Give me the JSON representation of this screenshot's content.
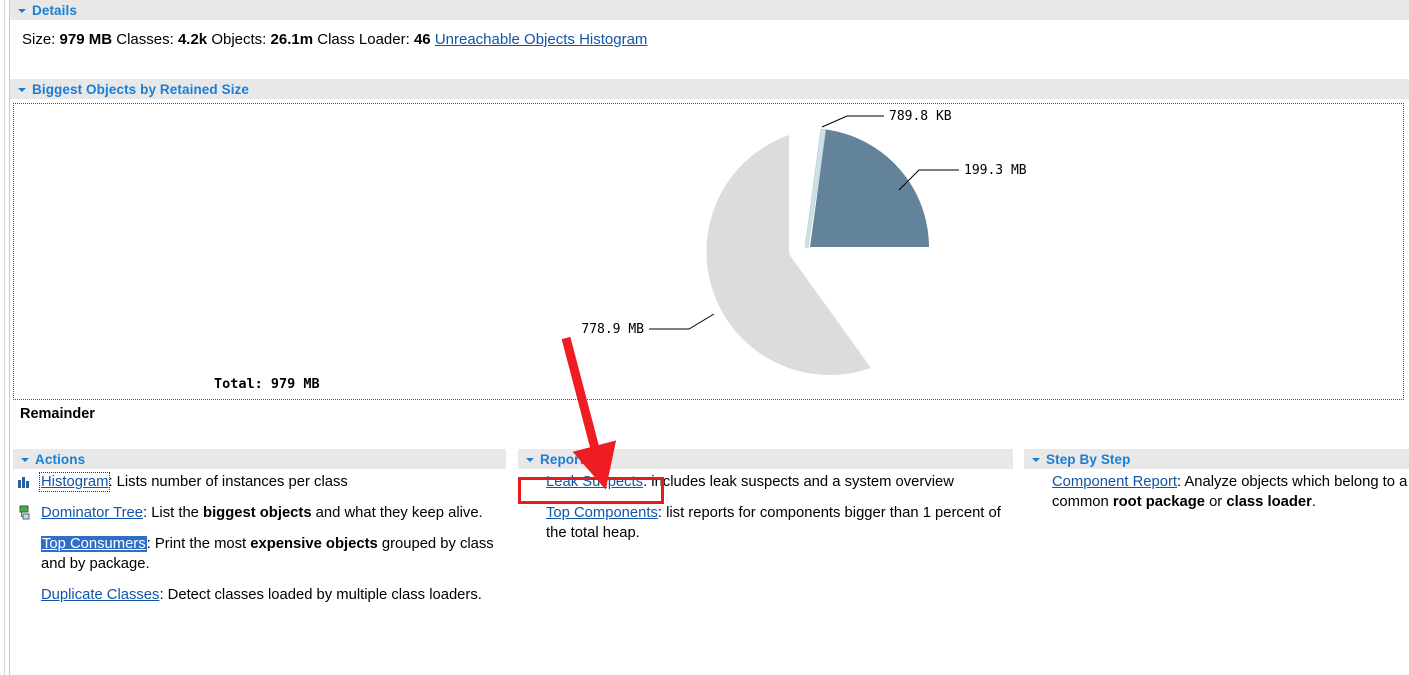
{
  "details": {
    "title": "Details",
    "size_label": "Size:",
    "size_value": "979 MB",
    "classes_label": "Classes:",
    "classes_value": "4.2k",
    "objects_label": "Objects:",
    "objects_value": "26.1m",
    "classloader_label": "Class Loader:",
    "classloader_value": "46",
    "unreachable_link": "Unreachable Objects Histogram"
  },
  "chart_section": {
    "title": "Biggest Objects by Retained Size",
    "remainder_label": "Remainder"
  },
  "chart_data": {
    "type": "pie",
    "title": "Biggest Objects by Retained Size",
    "total_label": "Total: 979 MB",
    "total_value": "979 MB",
    "labels": [
      "789.8 KB",
      "199.3 MB",
      "778.9 MB"
    ],
    "values": [
      0.7898,
      199.3,
      778.9
    ],
    "value_units": [
      "KB",
      "MB",
      "MB"
    ],
    "values_mb": [
      0.77,
      199.3,
      778.9
    ],
    "colors": [
      "#cfe0e6",
      "#63839a",
      "#dcdcdc"
    ],
    "legend": [
      "Remainder"
    ],
    "legend_position": "bottom-left",
    "exploded_slices": [
      0,
      1
    ],
    "grid": false
  },
  "actions": {
    "title": "Actions",
    "items": [
      {
        "icon": "histogram-icon",
        "link": "Histogram",
        "focused": true,
        "selected": false,
        "parts": [
          {
            "text": ": Lists number of instances per class",
            "bold": false
          }
        ]
      },
      {
        "icon": "dominator-tree-icon",
        "link": "Dominator Tree",
        "focused": false,
        "selected": false,
        "parts": [
          {
            "text": ": List the ",
            "bold": false
          },
          {
            "text": "biggest objects",
            "bold": true
          },
          {
            "text": " and what they keep alive.",
            "bold": false
          }
        ]
      },
      {
        "icon": "none",
        "link": "Top Consumers",
        "focused": false,
        "selected": true,
        "parts": [
          {
            "text": ": Print the most ",
            "bold": false
          },
          {
            "text": "expensive objects",
            "bold": true
          },
          {
            "text": " grouped by class and by package.",
            "bold": false
          }
        ]
      },
      {
        "icon": "none",
        "link": "Duplicate Classes",
        "focused": false,
        "selected": false,
        "parts": [
          {
            "text": ": Detect classes loaded by multiple class loaders.",
            "bold": false
          }
        ]
      }
    ]
  },
  "reports": {
    "title": "Reports",
    "items": [
      {
        "link": "Leak Suspects",
        "highlighted": true,
        "parts": [
          {
            "text": ": includes leak suspects and a system overview",
            "bold": false
          }
        ]
      },
      {
        "link": "Top Components",
        "highlighted": false,
        "parts": [
          {
            "text": ": list reports for components bigger than 1 percent of the total heap.",
            "bold": false
          }
        ]
      }
    ]
  },
  "steps": {
    "title": "Step By Step",
    "items": [
      {
        "link": "Component Report",
        "parts": [
          {
            "text": ": Analyze objects which belong to a common ",
            "bold": false
          },
          {
            "text": "root package",
            "bold": true
          },
          {
            "text": " or ",
            "bold": false
          },
          {
            "text": "class loader",
            "bold": true
          },
          {
            "text": ".",
            "bold": false
          }
        ]
      }
    ]
  },
  "annotation": {
    "arrow_color": "#ee1c23",
    "box_color": "#e8191b",
    "points_to": "Leak Suspects"
  }
}
